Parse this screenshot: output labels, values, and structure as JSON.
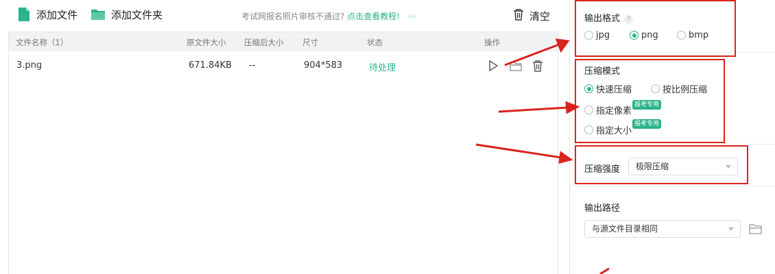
{
  "toolbar": {
    "add_file": "添加文件",
    "add_folder": "添加文件夹",
    "notice_text": "考试网报名照片审核不通过?",
    "notice_link": "点击查看教程!",
    "notice_chevrons": "›››",
    "clear": "清空"
  },
  "table": {
    "headers": {
      "name": "文件名称（1）",
      "orig_size": "原文件大小",
      "comp_size": "压缩后大小",
      "dim": "尺寸",
      "status": "状态",
      "ops": "操作"
    },
    "rows": [
      {
        "name": "3.png",
        "orig_size": "671.84KB",
        "comp_size": "--",
        "dim": "904*583",
        "status": "待处理"
      }
    ]
  },
  "settings": {
    "output_format": {
      "label": "输出格式",
      "help": "?",
      "options": [
        "jpg",
        "png",
        "bmp"
      ],
      "selected": "png"
    },
    "compress_mode": {
      "label": "压缩模式",
      "options": [
        "快速压缩",
        "按比例压缩",
        "指定像素",
        "指定大小"
      ],
      "selected": "快速压缩",
      "tag": "报考专用"
    },
    "compress_strength": {
      "label": "压缩强度",
      "value": "极限压缩"
    },
    "output_path": {
      "label": "输出路径",
      "value": "与源文件目录相同"
    }
  },
  "colors": {
    "accent": "#2bb38a",
    "annotation": "#d9231e"
  },
  "icons": [
    "file-icon",
    "folder-icon",
    "trash-icon",
    "play-icon",
    "open-folder-icon",
    "help-icon"
  ]
}
